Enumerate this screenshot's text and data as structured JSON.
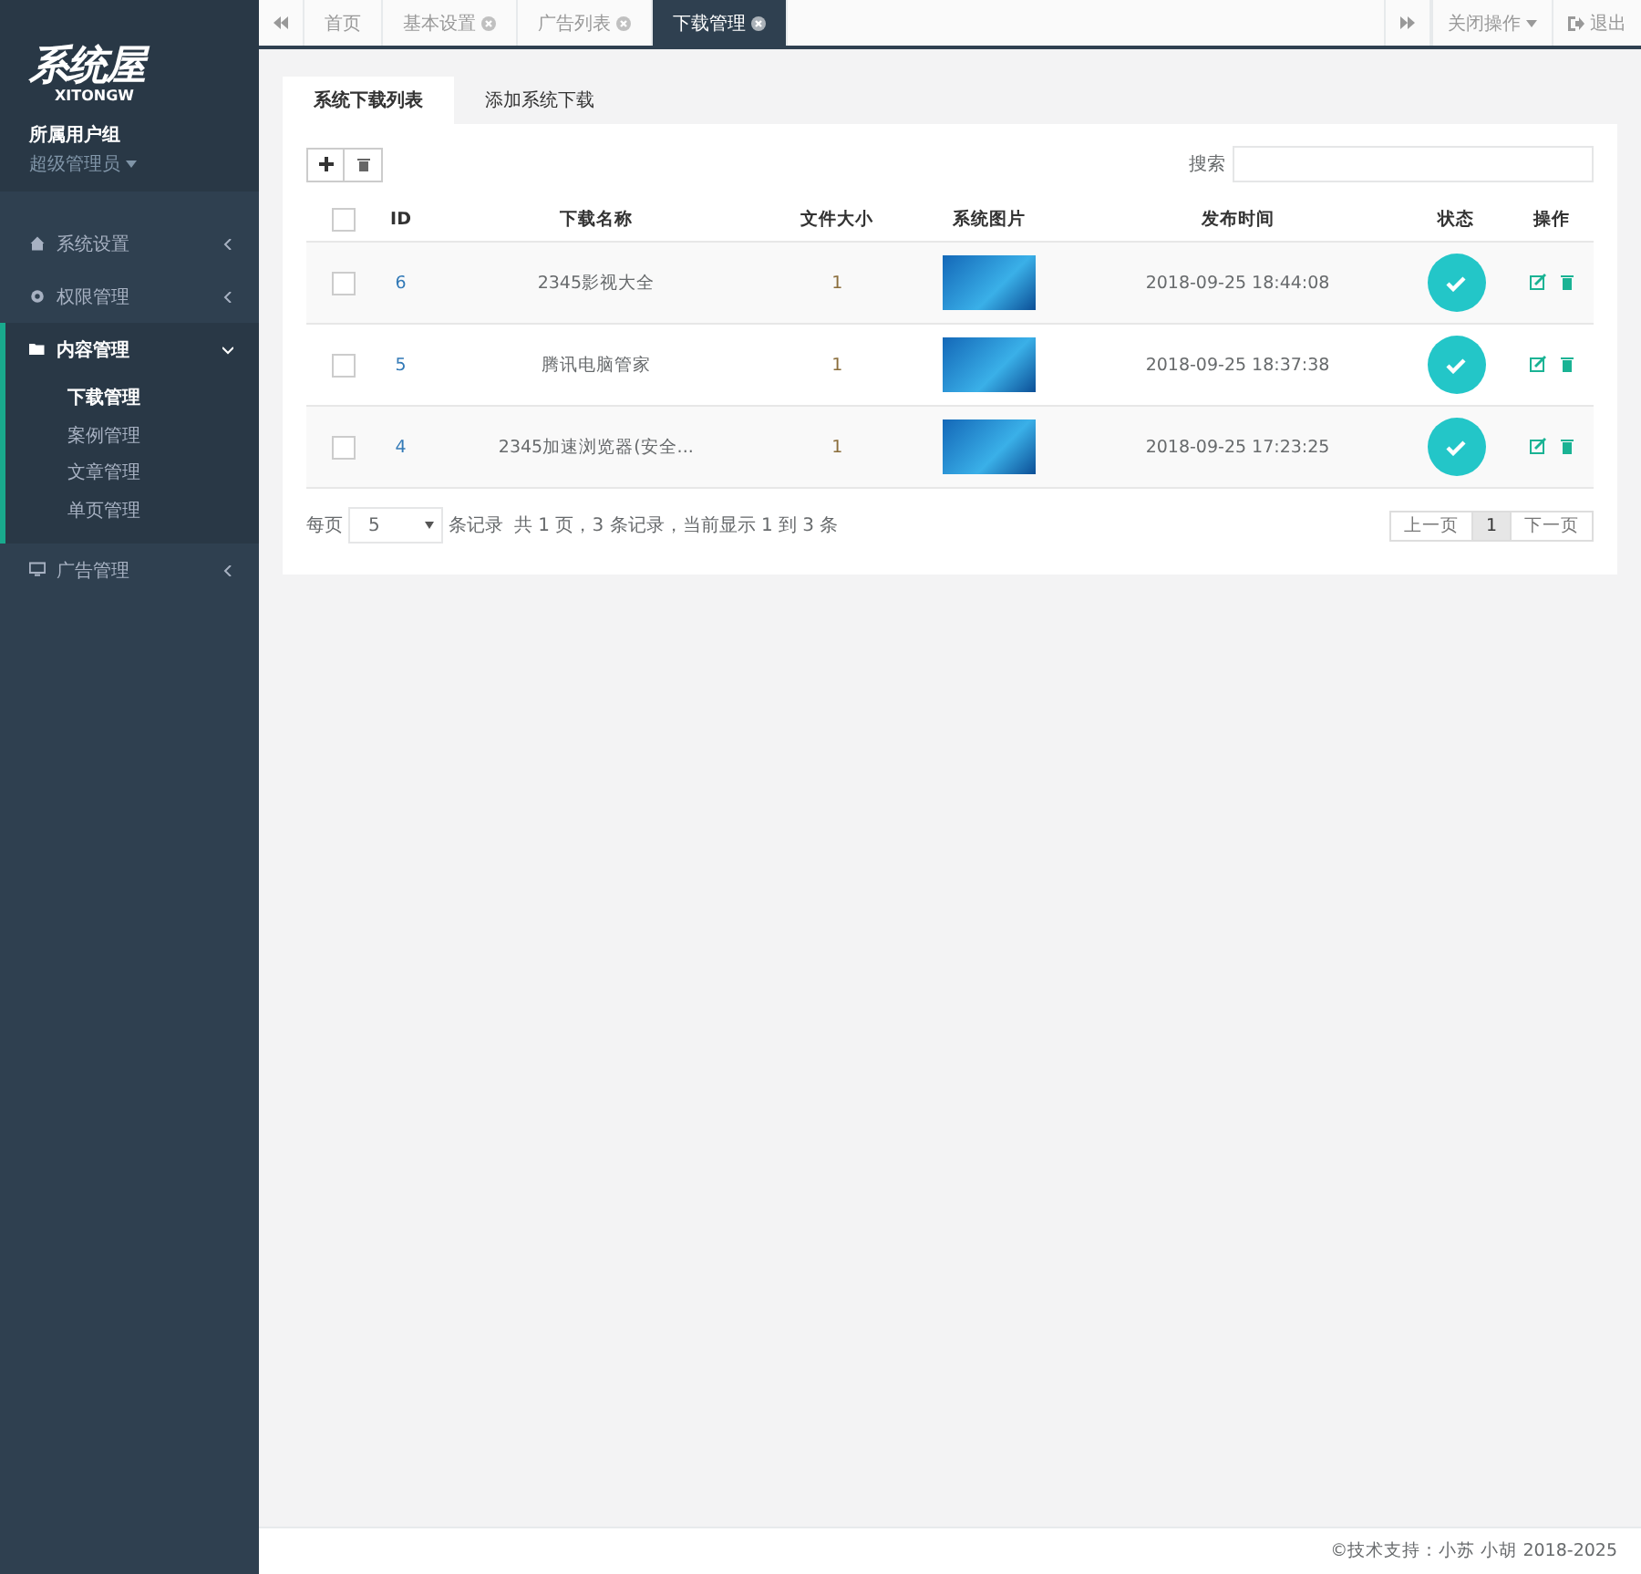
{
  "sidebar": {
    "logo_text": "系统屋",
    "logo_subtext": "XITONGW",
    "group_label": "所属用户组",
    "role": "超级管理员",
    "menu": [
      {
        "label": "系统设置",
        "expanded": false,
        "selected": false
      },
      {
        "label": "权限管理",
        "expanded": false,
        "selected": false
      },
      {
        "label": "内容管理",
        "expanded": true,
        "selected": true,
        "children": [
          {
            "label": "下载管理",
            "selected": true
          },
          {
            "label": "案例管理",
            "selected": false
          },
          {
            "label": "文章管理",
            "selected": false
          },
          {
            "label": "单页管理",
            "selected": false
          }
        ]
      },
      {
        "label": "广告管理",
        "expanded": false,
        "selected": false
      }
    ]
  },
  "page_tabs": [
    {
      "label": "首页",
      "closable": false,
      "selected": false
    },
    {
      "label": "基本设置",
      "closable": true,
      "selected": false
    },
    {
      "label": "广告列表",
      "closable": true,
      "selected": false
    },
    {
      "label": "下载管理",
      "closable": true,
      "selected": true
    }
  ],
  "close_menu": "关闭操作",
  "logout": "退出",
  "content_tabs": [
    {
      "label": "系统下载列表",
      "selected": true
    },
    {
      "label": "添加系统下载",
      "selected": false
    }
  ],
  "search": {
    "label": "搜索"
  },
  "table": {
    "all_checked": false,
    "columns": [
      "ID",
      "下载名称",
      "文件大小",
      "系统图片",
      "发布时间",
      "状态",
      "操作"
    ],
    "rows": [
      {
        "checked": false,
        "id": "6",
        "name": "2345影视大全",
        "size": "1",
        "time": "2018-09-25 18:44:08",
        "status": true
      },
      {
        "checked": false,
        "id": "5",
        "name": "腾讯电脑管家",
        "size": "1",
        "time": "2018-09-25 18:37:38",
        "status": true
      },
      {
        "checked": false,
        "id": "4",
        "name": "2345加速浏览器(安全...",
        "size": "1",
        "time": "2018-09-25 17:23:25",
        "status": true
      }
    ]
  },
  "pagination": {
    "per_page_label": "每页",
    "per_page": "5",
    "records_label": "条记录",
    "summary": "共 1 页，3 条记录，当前显示 1 到 3 条",
    "pages": [
      {
        "label": "上一页",
        "selected": false
      },
      {
        "label": "1",
        "selected": true
      },
      {
        "label": "下一页",
        "selected": false
      }
    ]
  },
  "footer": "©技术支持：小苏 小胡 2018-2025"
}
